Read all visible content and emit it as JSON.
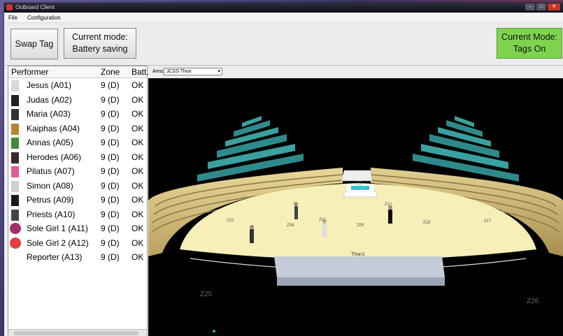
{
  "window": {
    "title": "Outboard Client"
  },
  "menu": [
    "File",
    "Configuration"
  ],
  "toolbar": {
    "swap_label": "Swap Tag",
    "mode_title": "Current mode:",
    "mode_value": "Battery saving",
    "tags_title": "Current Mode:",
    "tags_value": "Tags On",
    "tags_color": "#7ed44e"
  },
  "performers": {
    "headers": {
      "performer": "Performer",
      "zone": "Zone",
      "batt": "Batt."
    },
    "rows": [
      {
        "name": "Jesus (A01)",
        "zone": "9 (D)",
        "batt": "OK",
        "icon": "white-figure-icon",
        "color": "#d8d8d8"
      },
      {
        "name": "Judas (A02)",
        "zone": "9 (D)",
        "batt": "OK",
        "icon": "dark-figure-icon",
        "color": "#222222"
      },
      {
        "name": "Maria (A03)",
        "zone": "9 (D)",
        "batt": "OK",
        "icon": "dark-figure-icon",
        "color": "#333333"
      },
      {
        "name": "Kaiphas (A04)",
        "zone": "9 (D)",
        "batt": "OK",
        "icon": "gold-figure-icon",
        "color": "#b8862a"
      },
      {
        "name": "Annas (A05)",
        "zone": "9 (D)",
        "batt": "OK",
        "icon": "green-figure-icon",
        "color": "#3f8a3a"
      },
      {
        "name": "Herodes (A06)",
        "zone": "9 (D)",
        "batt": "OK",
        "icon": "dark-figure-icon",
        "color": "#3a2a2a"
      },
      {
        "name": "Pilatus (A07)",
        "zone": "9 (D)",
        "batt": "OK",
        "icon": "pink-figure-icon",
        "color": "#e05a9a"
      },
      {
        "name": "Simon (A08)",
        "zone": "9 (D)",
        "batt": "OK",
        "icon": "white-figure-icon",
        "color": "#cfcfcf"
      },
      {
        "name": "Petrus (A09)",
        "zone": "9 (D)",
        "batt": "OK",
        "icon": "dark-figure-icon",
        "color": "#1a1a1a"
      },
      {
        "name": "Priests (A10)",
        "zone": "9 (D)",
        "batt": "OK",
        "icon": "dark-figure-icon",
        "color": "#444444"
      },
      {
        "name": "Sole Girl 1 (A11)",
        "zone": "9 (D)",
        "batt": "OK",
        "icon": "purple-dot-icon",
        "color": "#a0306a"
      },
      {
        "name": "Sole Girl 2 (A12)",
        "zone": "9 (D)",
        "batt": "OK",
        "icon": "red-dot-icon",
        "color": "#e04040"
      },
      {
        "name": "Reporter (A13)",
        "zone": "9 (D)",
        "batt": "OK",
        "icon": "blank-icon",
        "color": "#ffffff"
      }
    ]
  },
  "area": {
    "label": "Area:",
    "selected": "JCSS Thun"
  },
  "stage": {
    "stage_label": "Thun1",
    "zones_big": [
      "Z25",
      "Z26"
    ],
    "zones_small": [
      "Z1",
      "Z08",
      "Z09",
      "Z18",
      "Z17",
      "Z10",
      "Z11",
      "Z12"
    ]
  }
}
